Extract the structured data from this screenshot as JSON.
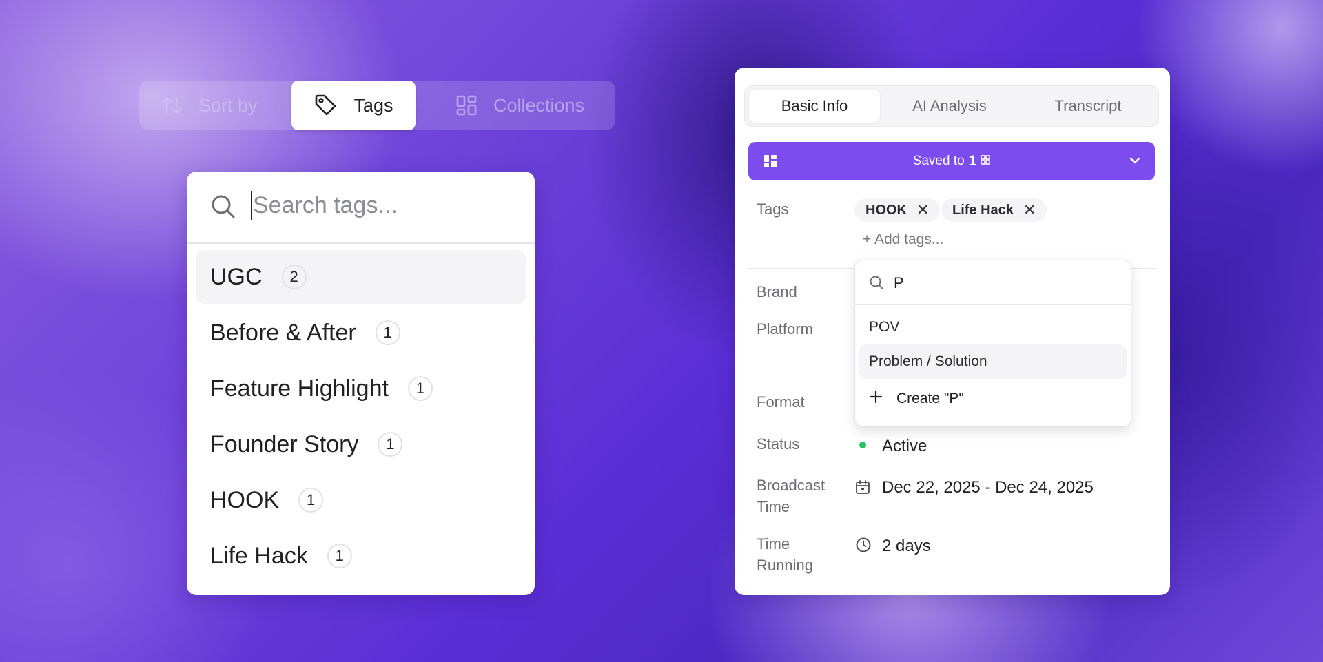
{
  "toolbar": {
    "sort_label": "Sort by",
    "tags_label": "Tags",
    "collections_label": "Collections"
  },
  "tag_search": {
    "placeholder": "Search tags...",
    "items": [
      {
        "label": "UGC",
        "count": "2"
      },
      {
        "label": "Before & After",
        "count": "1"
      },
      {
        "label": "Feature Highlight",
        "count": "1"
      },
      {
        "label": "Founder Story",
        "count": "1"
      },
      {
        "label": "HOOK",
        "count": "1"
      },
      {
        "label": "Life Hack",
        "count": "1"
      }
    ]
  },
  "detail": {
    "tabs": [
      "Basic Info",
      "AI Analysis",
      "Transcript"
    ],
    "active_tab": "Basic Info",
    "banner": {
      "text": "Saved to",
      "count": "1",
      "color": "#7d4cef"
    },
    "labels": {
      "tags": "Tags",
      "brand": "Brand",
      "platform": "Platform",
      "format": "Format",
      "status": "Status",
      "broadcast_time_1": "Broadcast",
      "broadcast_time_2": "Time",
      "time_running_1": "Time",
      "time_running_2": "Running"
    },
    "tags": [
      "HOOK",
      "Life Hack"
    ],
    "add_tags": "+ Add tags...",
    "status_value": "Active",
    "status_color": "#22c55e",
    "broadcast_value": "Dec 22, 2025 - Dec 24, 2025",
    "time_running_value": "2 days"
  },
  "tag_dropdown": {
    "query": "P",
    "options": [
      "POV",
      "Problem / Solution"
    ],
    "create_label": "Create \"P\""
  },
  "icons": [
    "sort-icon",
    "tag-icon",
    "collections-icon",
    "search-icon",
    "grid-icon",
    "chevron-down-icon",
    "close-icon",
    "plus-icon",
    "calendar-icon",
    "clock-icon"
  ]
}
